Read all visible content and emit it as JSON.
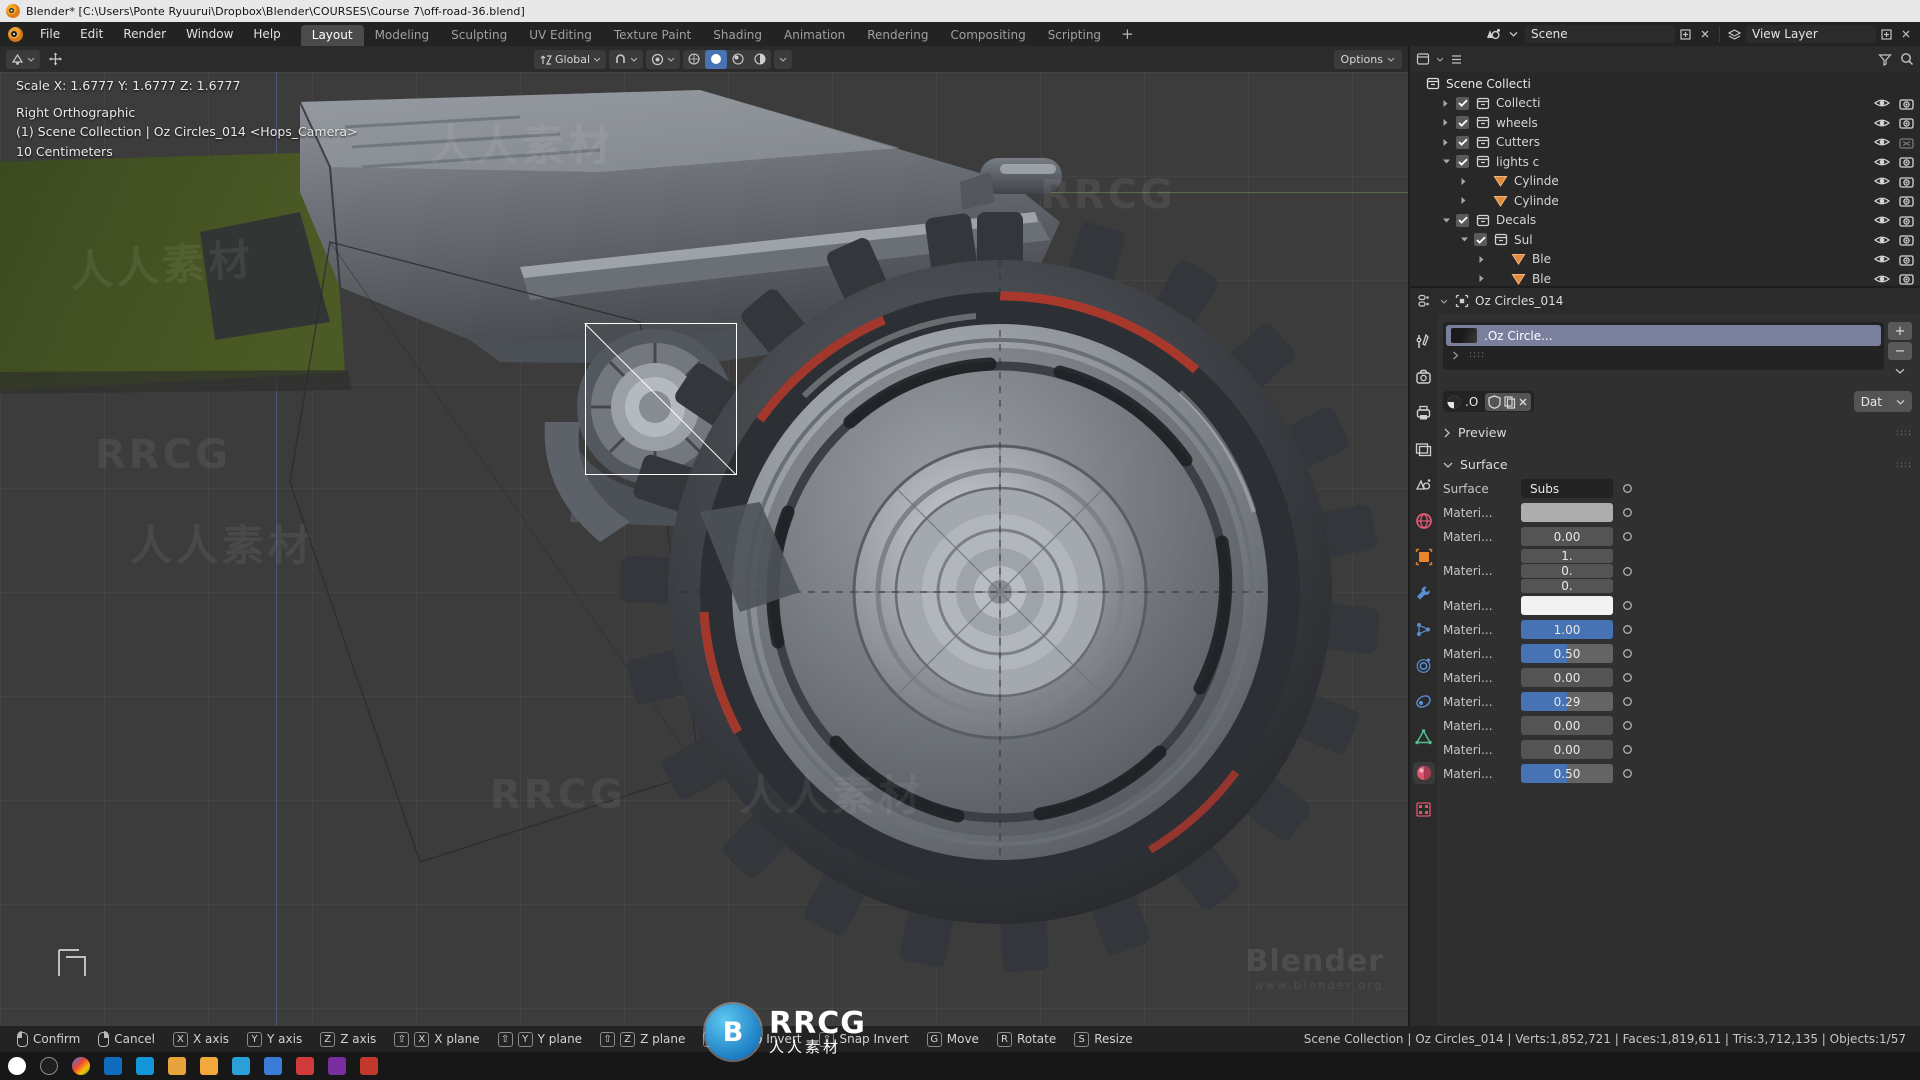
{
  "window": {
    "title": "Blender* [C:\\Users\\Ponte Ryuurui\\Dropbox\\Blender\\COURSES\\Course 7\\off-road-36.blend]"
  },
  "topbar": {
    "menus": [
      "File",
      "Edit",
      "Render",
      "Window",
      "Help"
    ],
    "workspaces": [
      {
        "label": "Layout",
        "active": true
      },
      {
        "label": "Modeling",
        "active": false
      },
      {
        "label": "Sculpting",
        "active": false
      },
      {
        "label": "UV Editing",
        "active": false
      },
      {
        "label": "Texture Paint",
        "active": false
      },
      {
        "label": "Shading",
        "active": false
      },
      {
        "label": "Animation",
        "active": false
      },
      {
        "label": "Rendering",
        "active": false
      },
      {
        "label": "Compositing",
        "active": false
      },
      {
        "label": "Scripting",
        "active": false
      }
    ],
    "add_workspace": "+",
    "scene_name": "Scene",
    "view_layer_name": "View Layer"
  },
  "viewport": {
    "editor_mode": "Object Mode",
    "transform_orientation": "Global",
    "options_label": "Options",
    "overlay": {
      "scale_line": "Scale X: 1.6777  Y: 1.6777  Z: 1.6777",
      "view_name": "Right Orthographic",
      "collection_line": "(1) Scene Collection | Oz Circles_014 <Hops_Camera>",
      "grid_scale": "10 Centimeters"
    }
  },
  "outliner": {
    "root": "Scene Collecti",
    "rows": [
      {
        "label": "Collecti",
        "indent": 1,
        "type": "collection",
        "expanded": false,
        "checked": true,
        "eye": true,
        "camera": true
      },
      {
        "label": "wheels",
        "indent": 1,
        "type": "collection",
        "expanded": false,
        "checked": true,
        "eye": true,
        "camera": true
      },
      {
        "label": "Cutters",
        "indent": 1,
        "type": "collection",
        "expanded": false,
        "checked": true,
        "eye": true,
        "camera": false
      },
      {
        "label": "lights c",
        "indent": 1,
        "type": "collection",
        "expanded": true,
        "checked": true,
        "eye": true,
        "camera": true
      },
      {
        "label": "Cylinde",
        "indent": 2,
        "type": "mesh",
        "expanded": false,
        "checked": null,
        "eye": true,
        "camera": true
      },
      {
        "label": "Cylinde",
        "indent": 2,
        "type": "mesh",
        "expanded": false,
        "checked": null,
        "eye": true,
        "camera": true
      },
      {
        "label": "Decals",
        "indent": 1,
        "type": "collection",
        "expanded": true,
        "checked": true,
        "eye": true,
        "camera": true
      },
      {
        "label": "Sul",
        "indent": 2,
        "type": "collection",
        "expanded": true,
        "checked": true,
        "eye": true,
        "camera": true
      },
      {
        "label": "Ble",
        "indent": 3,
        "type": "mesh",
        "expanded": false,
        "checked": null,
        "eye": true,
        "camera": true
      },
      {
        "label": "Ble",
        "indent": 3,
        "type": "mesh",
        "expanded": false,
        "checked": null,
        "eye": true,
        "camera": true
      }
    ]
  },
  "properties": {
    "breadcrumb_object": "Oz Circles_014",
    "material_slot": ".Oz Circle...",
    "id_name": ".O",
    "datablock_label": "Dat",
    "panels": [
      {
        "label": "Preview",
        "expanded": false
      },
      {
        "label": "Surface",
        "expanded": true
      }
    ],
    "surface_rows": [
      {
        "label": "Surface",
        "value": "Subs",
        "style": "dark"
      },
      {
        "label": "Materi...",
        "value": "",
        "style": "swatch-grey"
      },
      {
        "label": "Materi...",
        "value": "0.00",
        "style": "plain"
      },
      {
        "label": "Materi...",
        "value": [
          "1.",
          "0.",
          "0."
        ],
        "style": "vector"
      },
      {
        "label": "Materi...",
        "value": "",
        "style": "swatch-white"
      },
      {
        "label": "Materi...",
        "value": "1.00",
        "style": "blue"
      },
      {
        "label": "Materi...",
        "value": "0.50",
        "style": "half"
      },
      {
        "label": "Materi...",
        "value": "0.00",
        "style": "plain"
      },
      {
        "label": "Materi...",
        "value": "0.29",
        "style": "half"
      },
      {
        "label": "Materi...",
        "value": "0.00",
        "style": "plain"
      },
      {
        "label": "Materi...",
        "value": "0.00",
        "style": "plain"
      },
      {
        "label": "Materi...",
        "value": "0.50",
        "style": "half"
      }
    ]
  },
  "statusbar": {
    "keymap": [
      {
        "keys": [
          "mouse-left"
        ],
        "label": "Confirm"
      },
      {
        "keys": [
          "mouse-right"
        ],
        "label": "Cancel"
      },
      {
        "keys": [
          "X"
        ],
        "label": "X axis"
      },
      {
        "keys": [
          "Y"
        ],
        "label": "Y axis"
      },
      {
        "keys": [
          "Z"
        ],
        "label": "Z axis"
      },
      {
        "keys": [
          "⇧",
          "X"
        ],
        "label": "X plane"
      },
      {
        "keys": [
          "⇧",
          "Y"
        ],
        "label": "Y plane"
      },
      {
        "keys": [
          "⇧",
          "Z"
        ],
        "label": "Z plane"
      },
      {
        "keys": [
          "Ctrl"
        ],
        "label": "Snap Invert"
      },
      {
        "keys": [
          "⇧"
        ],
        "label": "Snap Invert"
      },
      {
        "keys": [
          "G"
        ],
        "label": "Move"
      },
      {
        "keys": [
          "R"
        ],
        "label": "Rotate"
      },
      {
        "keys": [
          "S"
        ],
        "label": "Resize"
      }
    ],
    "stats": "Scene Collection | Oz Circles_014 | Verts:1,852,721 | Faces:1,819,611 | Tris:3,712,135 | Objects:1/57"
  },
  "watermark": {
    "cn": "人人素材",
    "en": "RRCG",
    "badge_initial": "B",
    "blender_mark": "Blender",
    "blender_url": "www.blender.org"
  },
  "colors": {
    "accent_blue": "#4772b3",
    "orange": "#e87d0d",
    "panel_bg": "#303030",
    "header_bg": "#2b2b2b",
    "viewport_bg": "#3c3c3c"
  }
}
